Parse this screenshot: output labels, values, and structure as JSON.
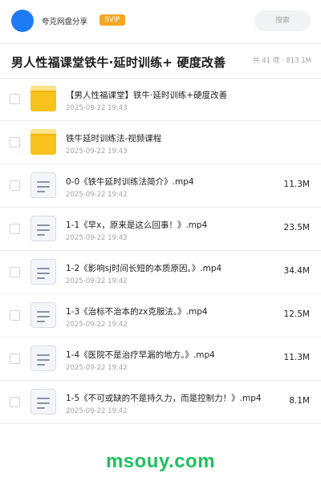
{
  "header": {
    "brand": "夸克网盘分享",
    "badge": "SVIP",
    "search_placeholder": "搜索"
  },
  "folder": {
    "title": "男人性福课堂铁牛·延时训练+ 硬度改善",
    "meta": "共 41 项 · 813.1M"
  },
  "files": [
    {
      "type": "folder",
      "name": "【男人性福课堂】铁牛·延时训练+硬度改善",
      "date": "2025-09-22 19:43",
      "size": ""
    },
    {
      "type": "folder",
      "name": "铁牛延时训练法-视频课程",
      "date": "2025-09-22 19:43",
      "size": ""
    },
    {
      "type": "file",
      "name": "0-0《铁牛延时训练法简介》.mp4",
      "date": "2025-09-22 19:42",
      "size": "11.3M"
    },
    {
      "type": "file",
      "name": "1-1《早x，原来是这么回事！》.mp4",
      "date": "2025-09-22 19:42",
      "size": "23.5M"
    },
    {
      "type": "file",
      "name": "1-2《影响sj时间长短的本质原因。》.mp4",
      "date": "2025-09-22 19:42",
      "size": "34.4M"
    },
    {
      "type": "file",
      "name": "1-3《治标不治本的zx克服法。》.mp4",
      "date": "2025-09-22 19:42",
      "size": "12.5M"
    },
    {
      "type": "file",
      "name": "1-4《医院不是治疗早漏的地方。》.mp4",
      "date": "2025-09-22 19:42",
      "size": "11.3M"
    },
    {
      "type": "file",
      "name": "1-5《不可或缺的不是持久力，而是控制力！》.mp4",
      "date": "2025-09-22 19:42",
      "size": "8.1M"
    }
  ],
  "watermark": "msouy.com",
  "colors": {
    "avatar": "#1e7bf6",
    "badge": "#f5a623",
    "folder": "#f8c21c",
    "watermark": "#1fbf5f"
  }
}
